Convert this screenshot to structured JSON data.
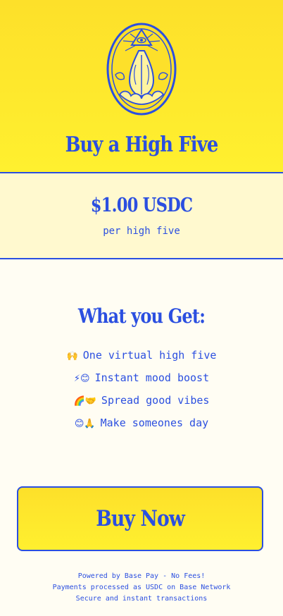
{
  "header": {
    "title": "Buy a High Five",
    "logo_icon": "hands-eye-emblem-icon"
  },
  "price": {
    "value": "$1.00 USDC",
    "unit": "per high five"
  },
  "benefits": {
    "title": "What you Get:",
    "items": [
      {
        "emoji": "🙌",
        "text": "One virtual high five"
      },
      {
        "emoji": "⚡😊",
        "text": "Instant mood boost"
      },
      {
        "emoji": "🌈🤝",
        "text": "Spread good vibes"
      },
      {
        "emoji": "😊🙏",
        "text": "Make someones day"
      }
    ]
  },
  "cta": {
    "label": "Buy Now"
  },
  "footer": {
    "line1": "Powered by Base Pay - No Fees!",
    "line2": "Payments processed as USDC on Base Network",
    "line3": "Secure and instant transactions"
  },
  "colors": {
    "accent": "#2b4fe0",
    "header_yellow": "#fde02a",
    "price_band": "#fff9cf",
    "page_background": "#fffdf3"
  }
}
